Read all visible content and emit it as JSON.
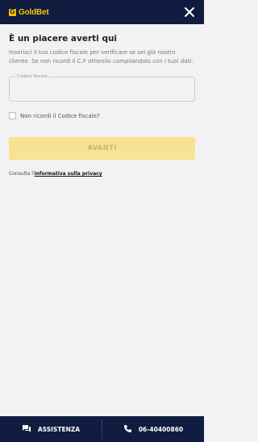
{
  "header": {
    "logo_mark": "G",
    "logo_text": "GoldBet",
    "close_icon": "close-icon"
  },
  "main": {
    "title": "È un piacere averti qui",
    "description": "Inserisci il tuo codice fiscale per verificare se sei già nostro cliente. Se non ricordi il C.F ottienilo compilandolo con i tuoi dati.",
    "field_label": "Codice fiscale",
    "field_value": "",
    "checkbox_label": "Non ricordi il Codice fiscale?",
    "button_label": "AVANTI",
    "privacy_prefix": "Consulta l'",
    "privacy_link": "informativa sulla privacy"
  },
  "footer": {
    "assistance_label": "ASSISTENZA",
    "phone_label": "06-40400860"
  },
  "colors": {
    "header_bg": "#0f1c3f",
    "brand_gold": "#f5c400",
    "button_disabled_bg": "#f8e393",
    "page_bg": "#f2f2f2"
  }
}
